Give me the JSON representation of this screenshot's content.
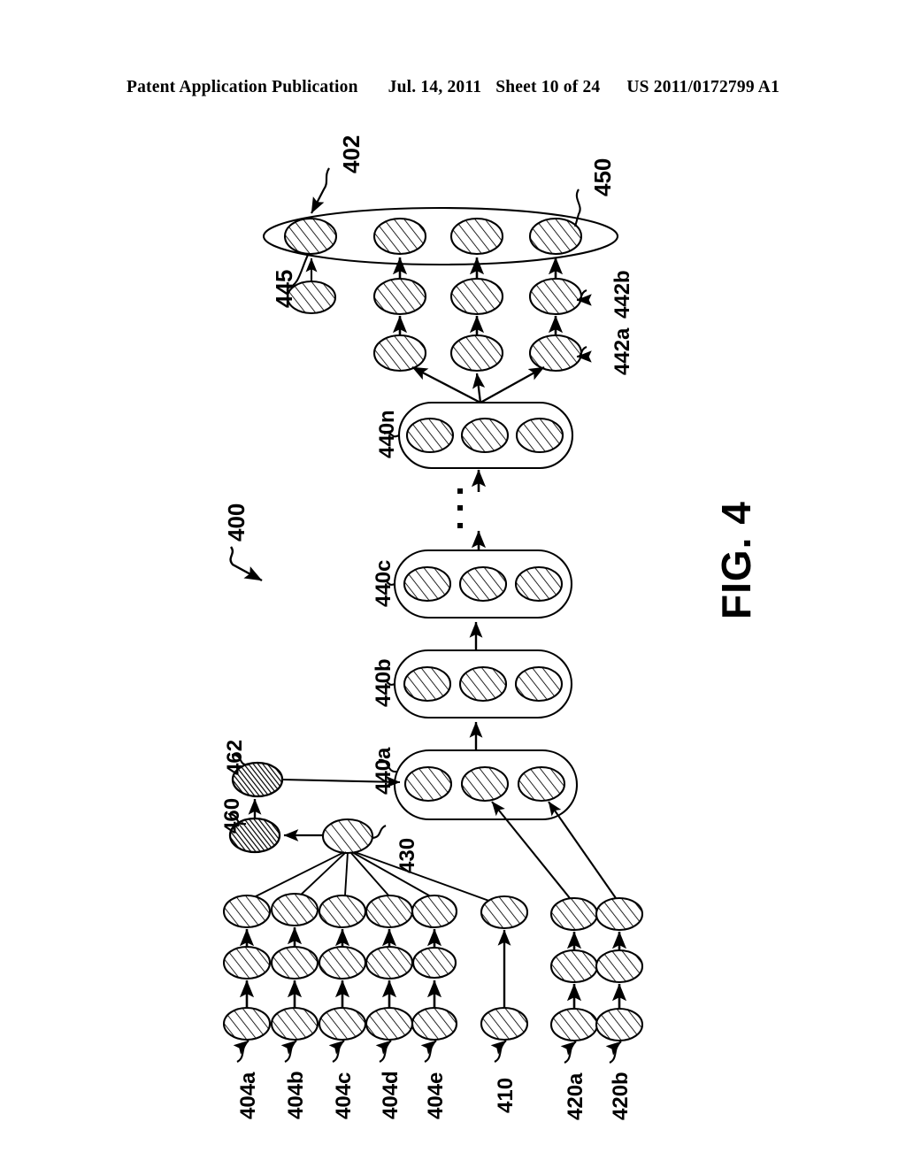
{
  "header": {
    "publication": "Patent Application Publication",
    "date": "Jul. 14, 2011",
    "sheet": "Sheet 10 of 24",
    "docnumber": "US 2011/0172799 A1"
  },
  "figure": {
    "title": "FIG. 4",
    "labels": {
      "ref_400": "400",
      "ref_402": "402",
      "ref_450": "450",
      "ref_445": "445",
      "ref_442a": "442a",
      "ref_442b": "442b",
      "ref_440a": "440a",
      "ref_440b": "440b",
      "ref_440c": "440c",
      "ref_440n": "440n",
      "ref_430": "430",
      "ref_460": "460",
      "ref_462": "462",
      "ref_404a": "404a",
      "ref_404b": "404b",
      "ref_404c": "404c",
      "ref_404d": "404d",
      "ref_404e": "404e",
      "ref_410": "410",
      "ref_420a": "420a",
      "ref_420b": "420b"
    },
    "colors": {
      "ink": "#000000",
      "paper": "#ffffff"
    }
  },
  "diagram_data": {
    "type": "node-graph",
    "orientation": "rotated-90",
    "groups": [
      {
        "id": "450",
        "shape": "large-ellipse",
        "node_count": 4,
        "label": "450",
        "pointer_label": "402"
      },
      {
        "id": "440n",
        "shape": "rounded-ellipse",
        "node_count": 3,
        "label": "440n"
      },
      {
        "id": "440c",
        "shape": "rounded-ellipse",
        "node_count": 3,
        "label": "440c"
      },
      {
        "id": "440b",
        "shape": "rounded-ellipse",
        "node_count": 3,
        "label": "440b"
      },
      {
        "id": "440a",
        "shape": "rounded-ellipse",
        "node_count": 3,
        "label": "440a"
      }
    ],
    "chains": [
      {
        "id": "404a",
        "label": "404a",
        "node_count": 3,
        "target": "430"
      },
      {
        "id": "404b",
        "label": "404b",
        "node_count": 3,
        "target": "430"
      },
      {
        "id": "404c",
        "label": "404c",
        "node_count": 3,
        "target": "430"
      },
      {
        "id": "404d",
        "label": "404d",
        "node_count": 3,
        "target": "430"
      },
      {
        "id": "404e",
        "label": "404e",
        "node_count": 3,
        "target": "430"
      },
      {
        "id": "410",
        "label": "410",
        "node_count": 2,
        "target": "430"
      },
      {
        "id": "420a",
        "label": "420a",
        "node_count": 3,
        "target": "440a"
      },
      {
        "id": "420b",
        "label": "420b",
        "node_count": 3,
        "target": "440a"
      },
      {
        "id": "442-col1",
        "label": "445",
        "node_count": 1,
        "target": "450"
      },
      {
        "id": "442-col2",
        "label": "",
        "node_count": 2,
        "target": "450"
      },
      {
        "id": "442-col3",
        "label": "",
        "node_count": 2,
        "target": "450"
      },
      {
        "id": "442-col4",
        "label": "442a/442b",
        "node_count": 2,
        "target": "450"
      }
    ],
    "special_nodes": [
      {
        "id": "430",
        "label": "430",
        "fill": "light-hatch"
      },
      {
        "id": "460",
        "label": "460",
        "fill": "dark-hatch"
      },
      {
        "id": "462",
        "label": "462",
        "fill": "dark-hatch"
      }
    ],
    "ellipsis": {
      "between": [
        "440c",
        "440n"
      ],
      "dots": 3
    }
  }
}
